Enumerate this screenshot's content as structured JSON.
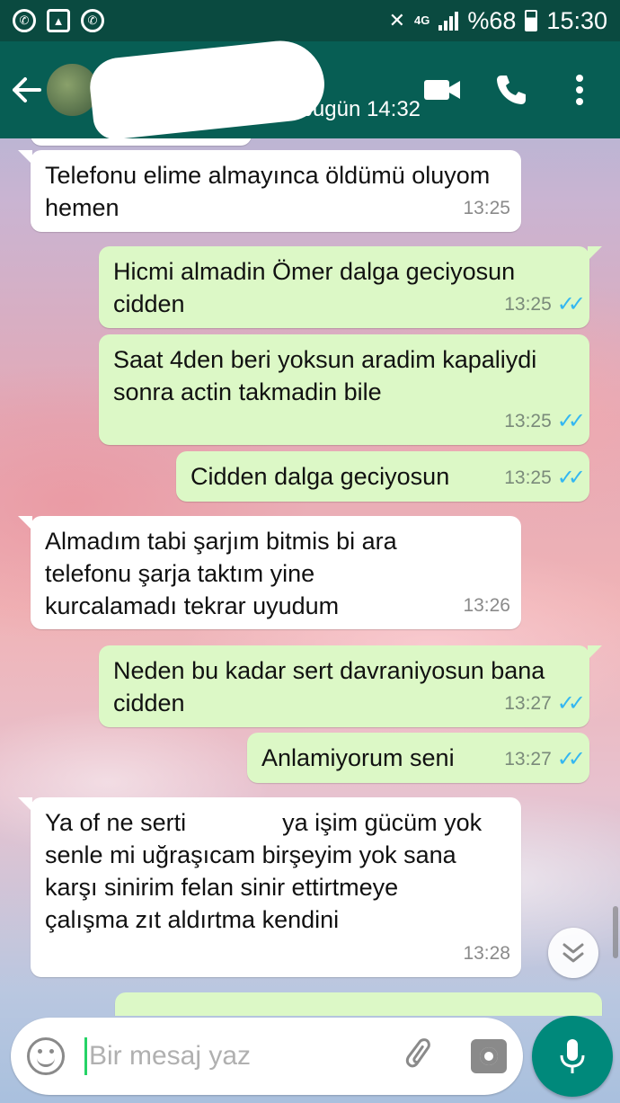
{
  "status_bar": {
    "battery_text": "%68",
    "time": "15:30",
    "network": "4G"
  },
  "toolbar": {
    "last_seen": "bugün 14:32"
  },
  "messages": [
    {
      "direction": "in",
      "text": "Telefonu elime almayınca öldümü oluyom hemen",
      "time": "13:25"
    },
    {
      "direction": "out",
      "text": "Hicmi almadin Ömer dalga geciyosun cidden",
      "time": "13:25",
      "status": "read"
    },
    {
      "direction": "out",
      "text": "Saat 4den beri yoksun aradim kapaliydi sonra actin takmadin bile",
      "time": "13:25",
      "status": "read"
    },
    {
      "direction": "out",
      "text": "Cidden dalga geciyosun",
      "time": "13:25",
      "status": "read"
    },
    {
      "direction": "in",
      "text": "Almadım tabi şarjım bitmis bi ara telefonu şarja taktım yine kurcalamadı tekrar uyudum",
      "time": "13:26"
    },
    {
      "direction": "out",
      "text": "Neden bu kadar sert davraniyosun bana cidden",
      "time": "13:27",
      "status": "read"
    },
    {
      "direction": "out",
      "text": "Anlamiyorum seni",
      "time": "13:27",
      "status": "read"
    },
    {
      "direction": "in",
      "text_before": "Ya of ne serti ",
      "text_after": " ya işim gücüm yok senle mi uğraşıcam birşeyim yok sana karşı sinirim felan sinir ettirtmeye çalışma zıt aldırtma kendini",
      "time": "13:28"
    }
  ],
  "composer": {
    "placeholder": "Bir mesaj yaz"
  },
  "colors": {
    "header": "#075e54",
    "status_bar": "#0a4a40",
    "outgoing_bubble": "#dcf8c6",
    "incoming_bubble": "#ffffff",
    "read_ticks": "#34b7f1",
    "mic_button": "#00897b"
  }
}
